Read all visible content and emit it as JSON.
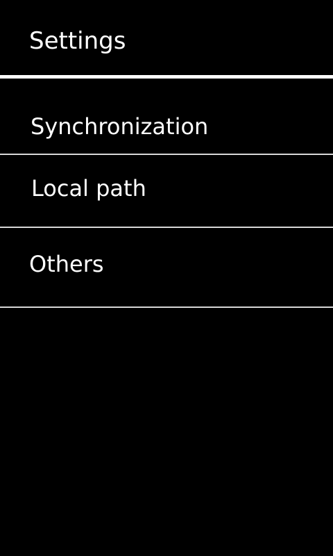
{
  "header": {
    "title": "Settings"
  },
  "settings_list": {
    "items": [
      {
        "label": "Synchronization"
      },
      {
        "label": "Local path"
      },
      {
        "label": "Others"
      }
    ]
  },
  "colors": {
    "background": "#000000",
    "text": "#ffffff",
    "header_divider": "#ffffff",
    "item_divider": "#d8d8d8"
  }
}
